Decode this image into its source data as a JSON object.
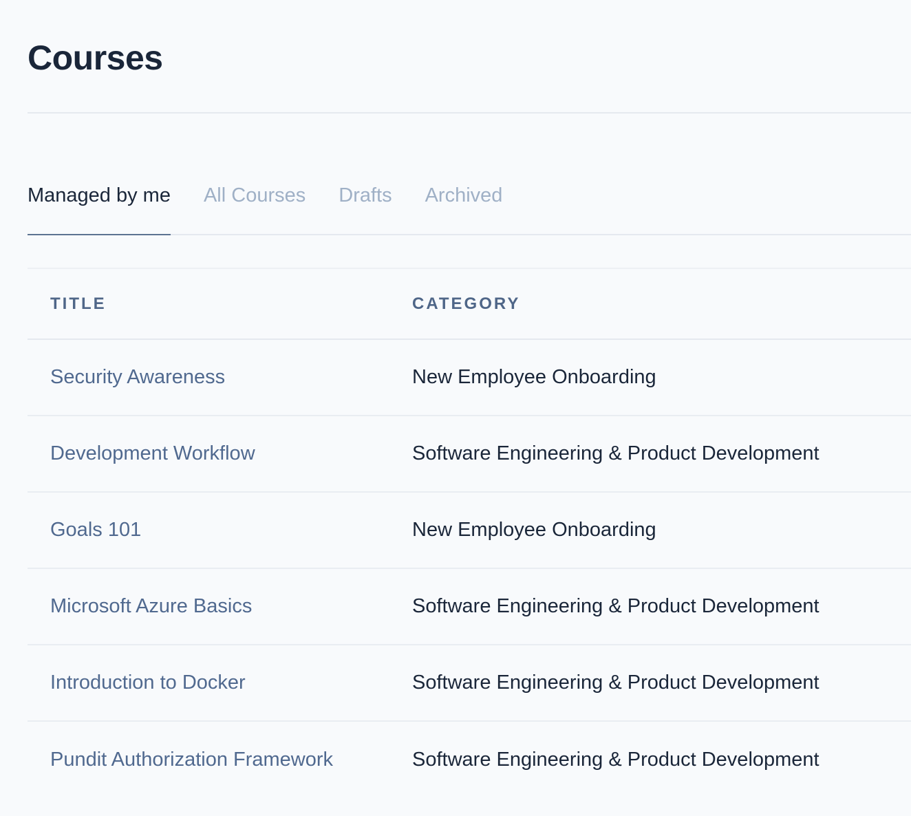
{
  "page": {
    "title": "Courses"
  },
  "tabs": [
    {
      "label": "Managed by me",
      "active": true
    },
    {
      "label": "All Courses",
      "active": false
    },
    {
      "label": "Drafts",
      "active": false
    },
    {
      "label": "Archived",
      "active": false
    }
  ],
  "table": {
    "headers": {
      "title": "TITLE",
      "category": "CATEGORY"
    },
    "rows": [
      {
        "title": "Security Awareness",
        "category": "New Employee Onboarding"
      },
      {
        "title": "Development Workflow",
        "category": "Software Engineering & Product Development"
      },
      {
        "title": "Goals 101",
        "category": "New Employee Onboarding"
      },
      {
        "title": "Microsoft Azure Basics",
        "category": "Software Engineering & Product Development"
      },
      {
        "title": "Introduction to Docker",
        "category": "Software Engineering & Product Development"
      },
      {
        "title": "Pundit Authorization Framework",
        "category": "Software Engineering & Product Development"
      }
    ]
  },
  "colors": {
    "background": "#f8fafc",
    "heading": "#1a2639",
    "tab_inactive": "#9fb0c6",
    "tab_indicator": "#5c7391",
    "link": "#50698f"
  }
}
